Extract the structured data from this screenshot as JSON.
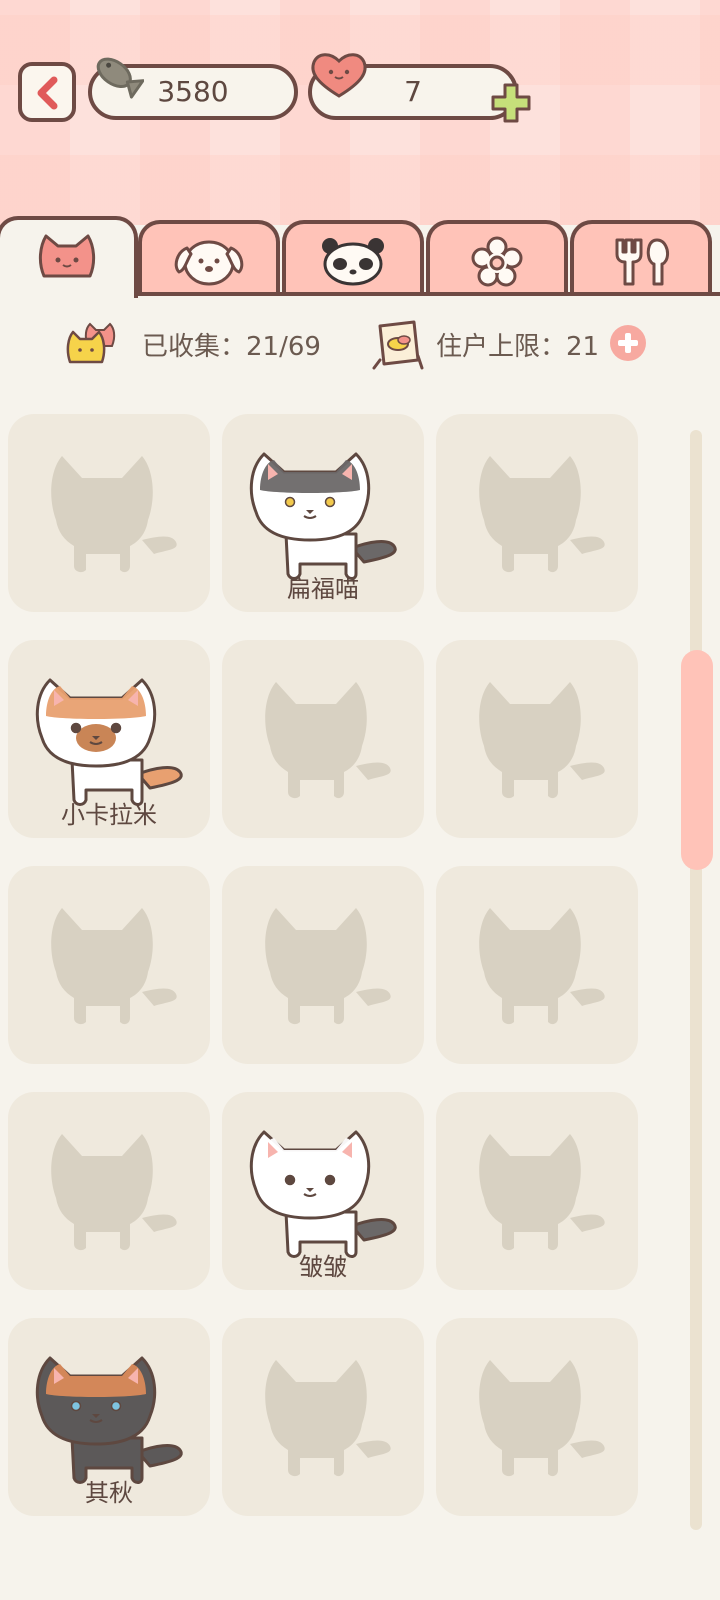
{
  "header": {
    "coins": "3580",
    "hearts": "7",
    "back_icon": "chevron-left-icon",
    "coin_icon": "fish-icon",
    "heart_icon": "heart-icon",
    "add_icon": "plus-icon"
  },
  "tabs": [
    {
      "icon": "cat-face-icon",
      "active": true
    },
    {
      "icon": "dog-face-icon",
      "active": false
    },
    {
      "icon": "panda-face-icon",
      "active": false
    },
    {
      "icon": "flower-icon",
      "active": false
    },
    {
      "icon": "fork-spoon-icon",
      "active": false
    }
  ],
  "info": {
    "collected_label": "已收集：21/69",
    "resident_label": "住户上限：21"
  },
  "cards": [
    {
      "name": "",
      "unlocked": false
    },
    {
      "name": "扁福喵",
      "unlocked": true,
      "fur": "#ffffff",
      "cap": "#6b6868",
      "tail": "#6b6868",
      "eyes": "#f2c94c"
    },
    {
      "name": "",
      "unlocked": false
    },
    {
      "name": "小卡拉米",
      "unlocked": true,
      "fur": "#ffffff",
      "cap": "#e8a070",
      "tail": "#e8a070",
      "eyes": "#5e4840",
      "muzzle": "#c98556"
    },
    {
      "name": "",
      "unlocked": false
    },
    {
      "name": "",
      "unlocked": false
    },
    {
      "name": "",
      "unlocked": false
    },
    {
      "name": "",
      "unlocked": false
    },
    {
      "name": "",
      "unlocked": false
    },
    {
      "name": "",
      "unlocked": false
    },
    {
      "name": "皱皱",
      "unlocked": true,
      "fur": "#ffffff",
      "cap": "#ffffff",
      "tail": "#6b6868",
      "eyes": "#5e4840"
    },
    {
      "name": "",
      "unlocked": false
    },
    {
      "name": "其秋",
      "unlocked": true,
      "fur": "#5c5959",
      "cap": "#d98a5a",
      "tail": "#5c5959",
      "eyes": "#7ec4e0"
    },
    {
      "name": "",
      "unlocked": false
    },
    {
      "name": "",
      "unlocked": false
    }
  ],
  "scroll": {
    "position": 0.2
  }
}
